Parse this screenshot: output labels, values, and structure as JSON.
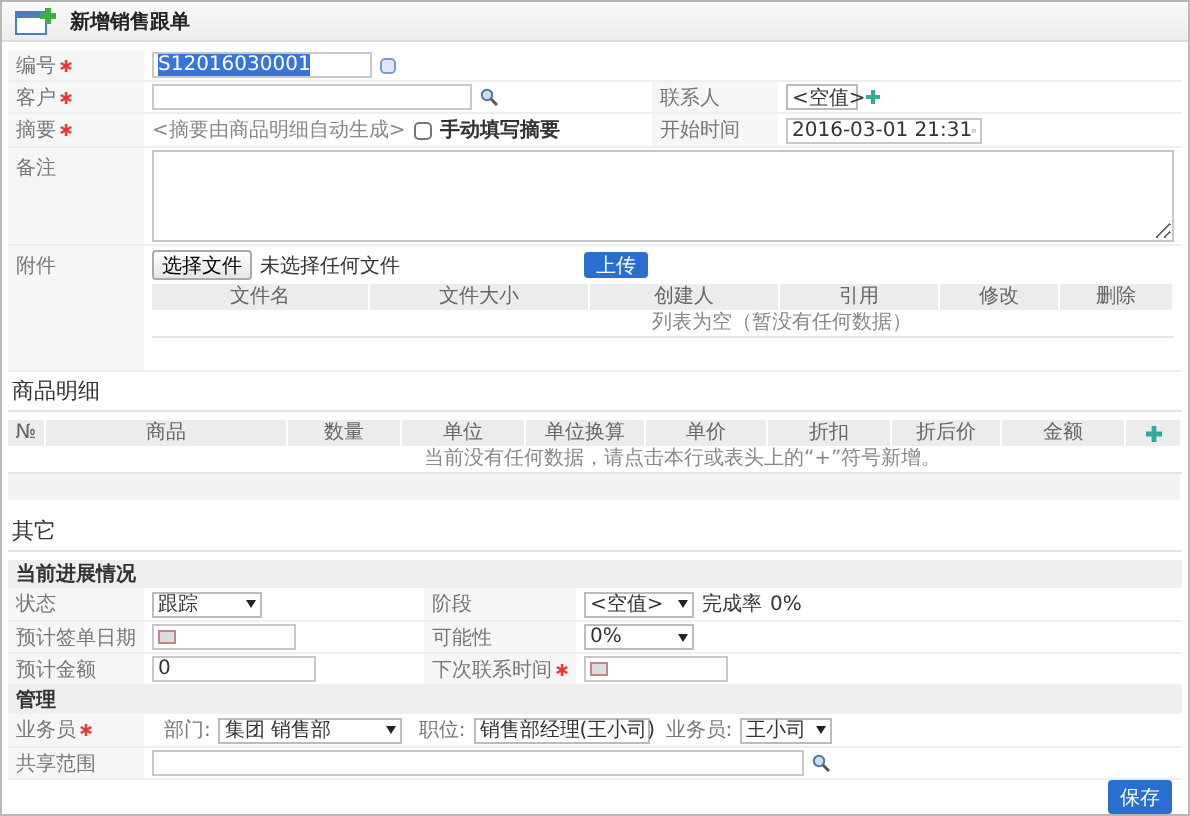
{
  "title": "新增销售跟单",
  "basic": {
    "number": {
      "label": "编号",
      "required": true,
      "value": "S12016030001",
      "value_selected": true
    },
    "customer": {
      "label": "客户",
      "required": true
    },
    "contact": {
      "label": "联系人",
      "value": "<空值>"
    },
    "summary": {
      "label": "摘要",
      "required": true,
      "hint": "<摘要由商品明细自动生成>",
      "checkbox_label": "手动填写摘要",
      "checked": false
    },
    "start_time": {
      "label": "开始时间",
      "value": "2016-03-01 21:31"
    },
    "remark": {
      "label": "备注"
    },
    "attachment": {
      "label": "附件",
      "choose_button": "选择文件",
      "file_status": "未选择任何文件",
      "upload_button": "上传",
      "columns": [
        "文件名",
        "文件大小",
        "创建人",
        "引用",
        "修改",
        "删除"
      ],
      "empty_message": "列表为空（暂没有任何数据）"
    }
  },
  "products": {
    "title": "商品明细",
    "columns": [
      "№",
      "商品",
      "数量",
      "单位",
      "单位换算",
      "单价",
      "折扣",
      "折后价",
      "金额"
    ],
    "empty_message": "当前没有任何数据，请点击本行或表头上的“+”符号新增。"
  },
  "other": {
    "title": "其它",
    "progress": {
      "title": "当前进展情况",
      "rows": [
        {
          "left": {
            "label": "状态",
            "required": false,
            "kind": "select",
            "value": "跟踪"
          },
          "right": {
            "label": "阶段",
            "required": false,
            "kind": "select",
            "value": "<空值>",
            "note_label": "完成率",
            "note_value": "0%"
          }
        },
        {
          "left": {
            "label": "预计签单日期",
            "required": false,
            "kind": "date"
          },
          "right": {
            "label": "可能性",
            "required": false,
            "kind": "select",
            "value": "0%"
          }
        },
        {
          "left": {
            "label": "预计金额",
            "required": false,
            "kind": "text",
            "value": "0"
          },
          "right": {
            "label": "下次联系时间",
            "required": true,
            "kind": "date"
          }
        }
      ]
    },
    "management": {
      "title": "管理",
      "salesman": {
        "label": "业务员",
        "required": true,
        "pickers": [
          {
            "label": "部门:",
            "value": "集团 销售部"
          },
          {
            "label": "职位:",
            "value": "销售部经理(王小司)"
          },
          {
            "label": "业务员:",
            "value": "王小司"
          }
        ]
      },
      "share": {
        "label": "共享范围",
        "required": false
      }
    }
  },
  "save_button": "保存"
}
